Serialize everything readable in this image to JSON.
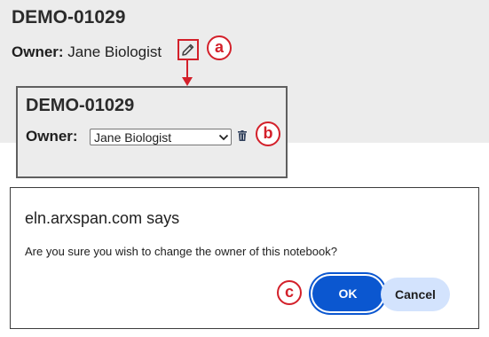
{
  "notebook": {
    "id": "DEMO-01029",
    "owner_label": "Owner:",
    "owner_name": "Jane Biologist"
  },
  "edit_panel": {
    "id": "DEMO-01029",
    "owner_label": "Owner:",
    "selected_owner": "Jane Biologist"
  },
  "dialog": {
    "origin": "eln.arxspan.com says",
    "message": "Are you sure you wish to change the owner of this notebook?",
    "ok_label": "OK",
    "cancel_label": "Cancel"
  },
  "callouts": {
    "a": "a",
    "b": "b",
    "c": "c"
  },
  "icons": {
    "edit": "pencil-icon",
    "delete": "trash-icon",
    "dropdown": "chevron-down-icon"
  },
  "colors": {
    "accent": "#d3202a",
    "primary_button": "#0b57d0",
    "secondary_button": "#d3e3fd",
    "panel_bg": "#ececec"
  }
}
